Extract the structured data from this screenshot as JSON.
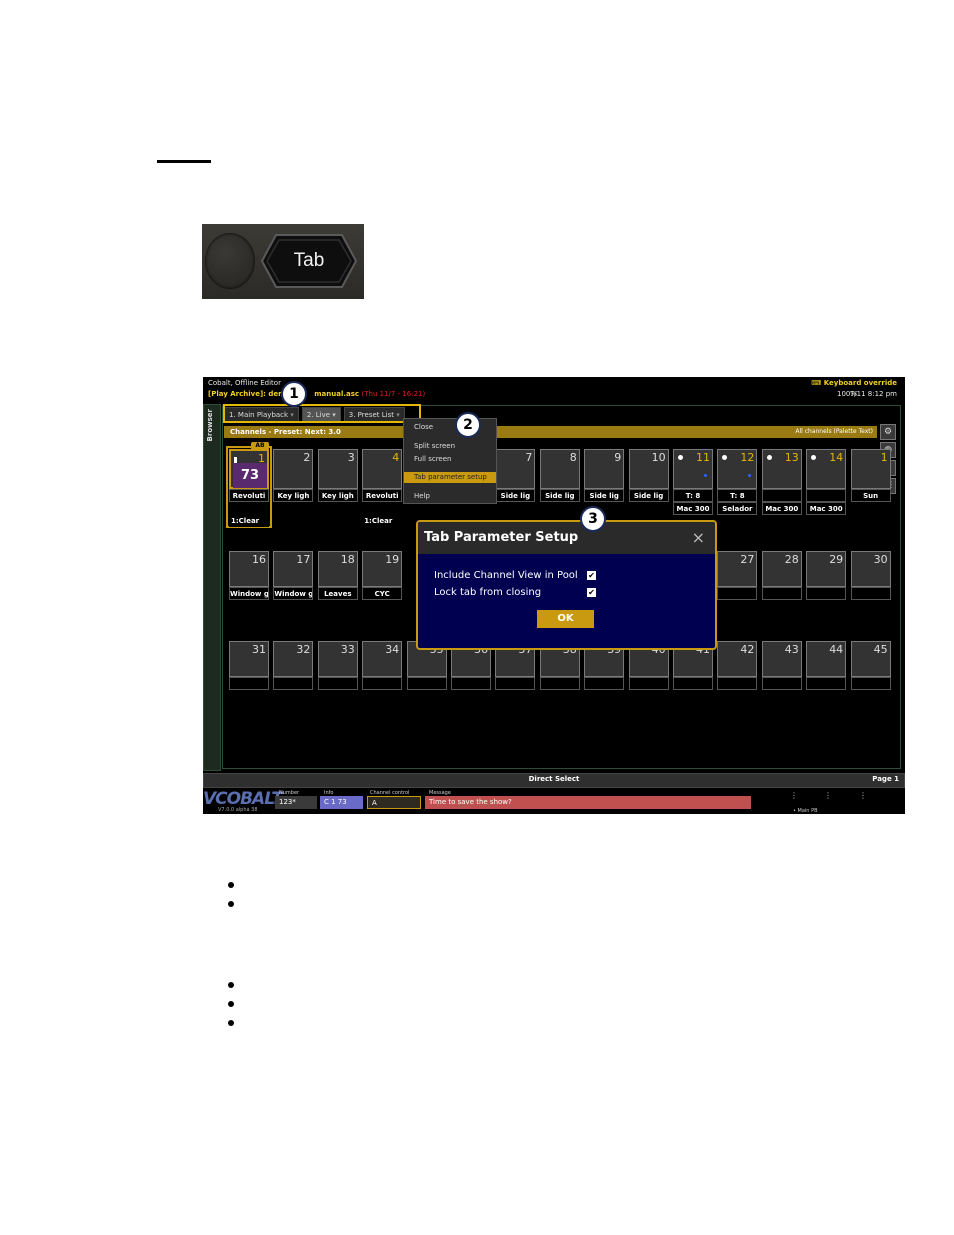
{
  "tab_key": {
    "label": "Tab"
  },
  "screen": {
    "app_title": "Cobalt, Offline Editor",
    "archive_prefix": "[Play Archive]: demo",
    "archive_file": "manual.asc",
    "archive_date": "(Thu 11/7 - 16:21)",
    "keyboard_override": "Keyboard override",
    "zoom": "100%",
    "datetime": "7/11 8:12 pm",
    "browser_label": "Browser",
    "tabs": [
      "1. Main Playback",
      "2. Live",
      "3. Preset List"
    ],
    "header_left": "Channels - Preset:    Next: 3.0",
    "header_right": "All channels (Palette Text)",
    "context_menu": [
      "Close",
      "Split screen",
      "Full screen",
      "Tab parameter setup",
      "Help"
    ],
    "channels_row1": [
      {
        "n": "1",
        "gold": true,
        "value": "73",
        "ab": "AB",
        "label": "Revoluti",
        "cue": "1:Clear"
      },
      {
        "n": "2",
        "label": "Key ligh"
      },
      {
        "n": "3",
        "label": "Key ligh"
      },
      {
        "n": "4",
        "gold": true,
        "label": "Revoluti",
        "cue": "1:Clear"
      },
      {
        "n": "7",
        "label": "Side lig"
      },
      {
        "n": "8",
        "label": "Side lig"
      },
      {
        "n": "9",
        "label": "Side lig"
      },
      {
        "n": "10",
        "label": "Side lig"
      },
      {
        "n": "11",
        "gold": true,
        "dot": true,
        "bdot": true,
        "label": "T: 8",
        "label2": "Mac 300"
      },
      {
        "n": "12",
        "gold": true,
        "dot": true,
        "bdot": true,
        "label": "T: 8",
        "label2": "Selador"
      },
      {
        "n": "13",
        "gold": true,
        "dot": true,
        "label2": "Mac 300"
      },
      {
        "n": "14",
        "gold": true,
        "dot": true,
        "label2": "Mac 300"
      },
      {
        "n": "1",
        "gold": true,
        "label": "Sun"
      }
    ],
    "channels_row2": [
      {
        "n": "16",
        "label": "Window g"
      },
      {
        "n": "17",
        "label": "Window g"
      },
      {
        "n": "18",
        "label": "Leaves"
      },
      {
        "n": "19",
        "label": "CYC"
      },
      {
        "n": "27"
      },
      {
        "n": "28"
      },
      {
        "n": "29"
      },
      {
        "n": "30"
      }
    ],
    "channels_row3": [
      "31",
      "32",
      "33",
      "34",
      "35",
      "36",
      "37",
      "38",
      "39",
      "40",
      "41",
      "42",
      "43",
      "44",
      "45"
    ],
    "dialog": {
      "title": "Tab Parameter Setup",
      "close": "×",
      "option1": "Include Channel View in Pool",
      "option2": "Lock tab from closing",
      "checkmark": "✔",
      "ok": "OK"
    },
    "callouts": [
      "1",
      "2",
      "3"
    ],
    "direct_select": "Direct Select",
    "page": "Page 1",
    "logo": "VCOBALT",
    "version": "V7.0.0 alpha 38",
    "fields": {
      "number_label": "Number",
      "number_value": "123*",
      "info_label": "Info",
      "info_value": "C  1 73",
      "channel_label": "Channel control",
      "channel_value": "A",
      "message_label": "Message",
      "message_value": "Time to save the show?"
    },
    "main_pb": "• Main PB",
    "colors": {
      "gold": "#c99a10",
      "purple": "#5a2a6e",
      "message_red": "#c05050",
      "info_blue": "#6a6ac8",
      "dialog_bg": "#000050"
    }
  }
}
